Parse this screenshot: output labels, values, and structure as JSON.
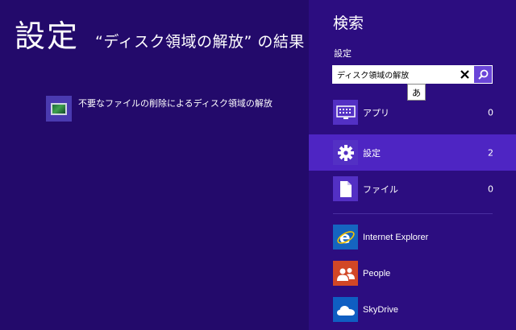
{
  "results": {
    "title": "設定",
    "query_caption": "“ディスク領域の解放” の結果",
    "items": [
      {
        "label": "不要なファイルの削除によるディスク領域の解放",
        "icon": "disk-cleanup-icon"
      }
    ]
  },
  "search": {
    "title": "検索",
    "scope": "設定",
    "query": "ディスク領域の解放",
    "ime_indicator": "あ",
    "categories": [
      {
        "label": "アプリ",
        "count": "0",
        "icon": "keyboard-icon",
        "selected": false
      },
      {
        "label": "設定",
        "count": "2",
        "icon": "gear-icon",
        "selected": true
      },
      {
        "label": "ファイル",
        "count": "0",
        "icon": "document-icon",
        "selected": false
      }
    ],
    "apps": [
      {
        "label": "Internet Explorer",
        "icon": "internet-explorer-icon",
        "color": "#1565c0"
      },
      {
        "label": "People",
        "icon": "people-icon",
        "color": "#d24726"
      },
      {
        "label": "SkyDrive",
        "icon": "cloud-icon",
        "color": "#0f5ec2"
      }
    ]
  },
  "colors": {
    "background": "#230a6b",
    "pane_background": "#2c0d80",
    "selected_row": "#4e25c3",
    "accent": "#6a45d8"
  }
}
